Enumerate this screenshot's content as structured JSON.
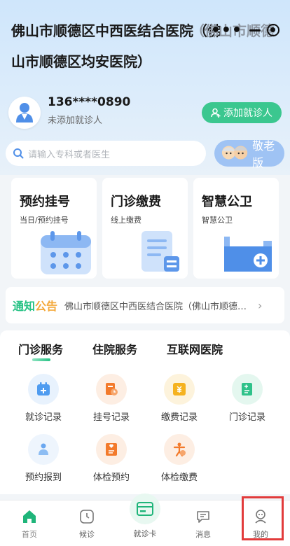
{
  "header": {
    "title": "佛山市顺德区中西医结合医院（佛山市顺德区均安医院）",
    "title_overflow": "（佛山市顺德"
  },
  "user": {
    "phone": "136****0890",
    "status": "未添加就诊人",
    "add_button": "添加就诊人"
  },
  "search": {
    "placeholder": "请输入专科或者医生"
  },
  "elder_mode": {
    "label": "敬老版"
  },
  "cards": [
    {
      "title": "预约挂号",
      "subtitle": "当日/预约挂号",
      "icon": "calendar-icon"
    },
    {
      "title": "门诊缴费",
      "subtitle": "线上缴费",
      "icon": "bill-icon"
    },
    {
      "title": "智慧公卫",
      "subtitle": "智慧公卫",
      "icon": "folder-icon"
    }
  ],
  "notice": {
    "tag_1": "通知",
    "tag_2": "公告",
    "text": "佛山市顺德区中西医结合医院（佛山市顺德区均安医院）"
  },
  "tabs": [
    "门诊服务",
    "住院服务",
    "互联网医院"
  ],
  "services": [
    {
      "label": "就诊记录",
      "icon": "calendar-record-icon"
    },
    {
      "label": "挂号记录",
      "icon": "register-record-icon"
    },
    {
      "label": "缴费记录",
      "icon": "payment-record-icon"
    },
    {
      "label": "门诊记录",
      "icon": "clinic-record-icon"
    },
    {
      "label": "预约报到",
      "icon": "checkin-icon"
    },
    {
      "label": "体检预约",
      "icon": "exam-booking-icon"
    },
    {
      "label": "体检缴费",
      "icon": "exam-payment-icon"
    }
  ],
  "bottom_nav": {
    "home": "首页",
    "queue": "候诊",
    "card": "就诊卡",
    "messages": "消息",
    "mine": "我的"
  },
  "colors": {
    "accent_green": "#27c285",
    "add_button": "#3bc78f",
    "notice_orange": "#f4a93b",
    "highlight_red": "#e23b3b"
  }
}
